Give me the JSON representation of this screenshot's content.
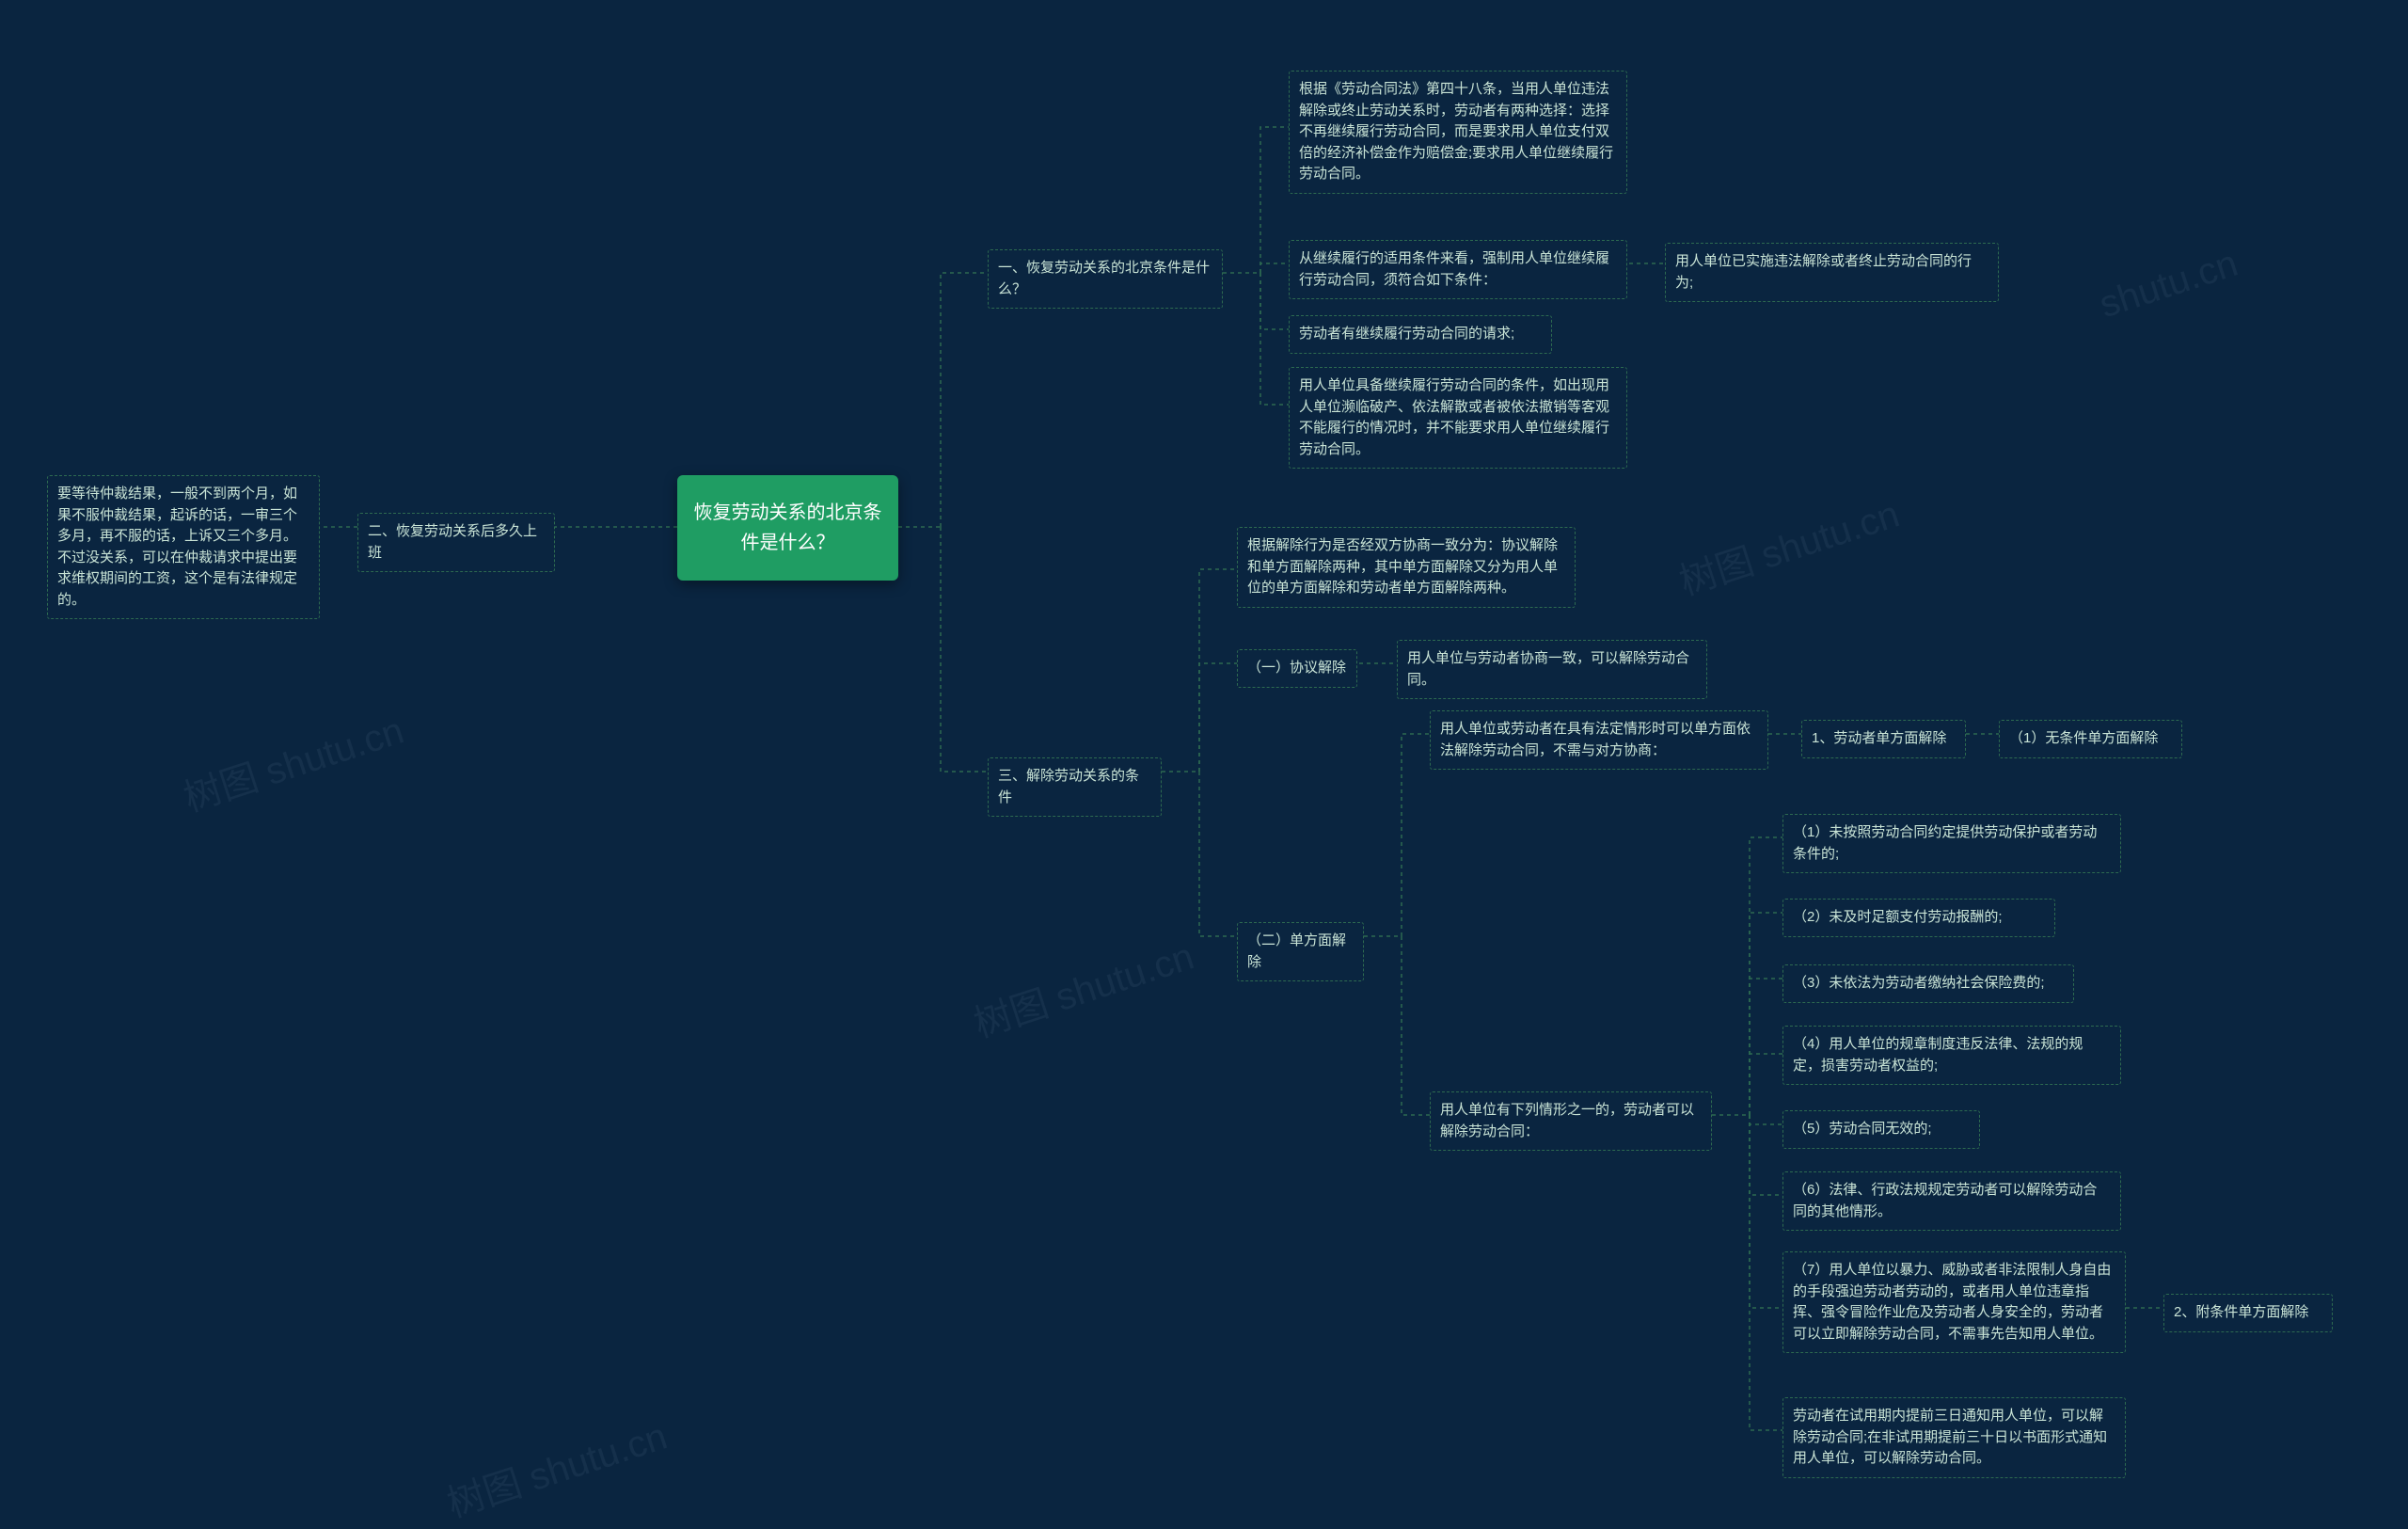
{
  "watermarks": [
    {
      "t": "树图 shutu.cn"
    },
    {
      "t": "树图 shutu.cn"
    },
    {
      "t": "树图 shutu.cn"
    },
    {
      "t": "树图 shutu.cn"
    },
    {
      "t": "shutu.cn"
    }
  ],
  "root": "恢复劳动关系的北京条件是什么？",
  "b2": "二、恢复劳动关系后多久上班",
  "b2_detail": "要等待仲裁结果，一般不到两个月，如果不服仲裁结果，起诉的话，一审三个多月，再不服的话，上诉又三个多月。不过没关系，可以在仲裁请求中提出要求维权期间的工资，这个是有法律规定的。",
  "b1": "一、恢复劳动关系的北京条件是什么？",
  "b1_1": "根据《劳动合同法》第四十八条，当用人单位违法解除或终止劳动关系时，劳动者有两种选择：选择不再继续履行劳动合同，而是要求用人单位支付双倍的经济补偿金作为赔偿金;要求用人单位继续履行劳动合同。",
  "b1_2": "从继续履行的适用条件来看，强制用人单位继续履行劳动合同，须符合如下条件：",
  "b1_2_a": "用人单位已实施违法解除或者终止劳动合同的行为;",
  "b1_3": "劳动者有继续履行劳动合同的请求;",
  "b1_4": "用人单位具备继续履行劳动合同的条件，如出现用人单位濒临破产、依法解散或者被依法撤销等客观不能履行的情况时，并不能要求用人单位继续履行劳动合同。",
  "b3": "三、解除劳动关系的条件",
  "b3_1": "根据解除行为是否经双方协商一致分为：协议解除和单方面解除两种，其中单方面解除又分为用人单位的单方面解除和劳动者单方面解除两种。",
  "b3_2": "（一）协议解除",
  "b3_2_a": "用人单位与劳动者协商一致，可以解除劳动合同。",
  "b3_3": "（二）单方面解除",
  "b3_3_a": "用人单位或劳动者在具有法定情形时可以单方面依法解除劳动合同，不需与对方协商：",
  "b3_3_a1": "1、劳动者单方面解除",
  "b3_3_a2": "（1）无条件单方面解除",
  "b3_3_b": "用人单位有下列情形之一的，劳动者可以解除劳动合同：",
  "b3_3_b1": "（1）未按照劳动合同约定提供劳动保护或者劳动条件的;",
  "b3_3_b2": "（2）未及时足额支付劳动报酬的;",
  "b3_3_b3": "（3）未依法为劳动者缴纳社会保险费的;",
  "b3_3_b4": "（4）用人单位的规章制度违反法律、法规的规定，损害劳动者权益的;",
  "b3_3_b5": "（5）劳动合同无效的;",
  "b3_3_b6": "（6）法律、行政法规规定劳动者可以解除劳动合同的其他情形。",
  "b3_3_b7": "（7）用人单位以暴力、威胁或者非法限制人身自由的手段强迫劳动者劳动的，或者用人单位违章指挥、强令冒险作业危及劳动者人身安全的，劳动者可以立即解除劳动合同，不需事先告知用人单位。",
  "b3_3_b7_a": "2、附条件单方面解除",
  "b3_3_b8": "劳动者在试用期内提前三日通知用人单位，可以解除劳动合同;在非试用期提前三十日以书面形式通知用人单位，可以解除劳动合同。"
}
